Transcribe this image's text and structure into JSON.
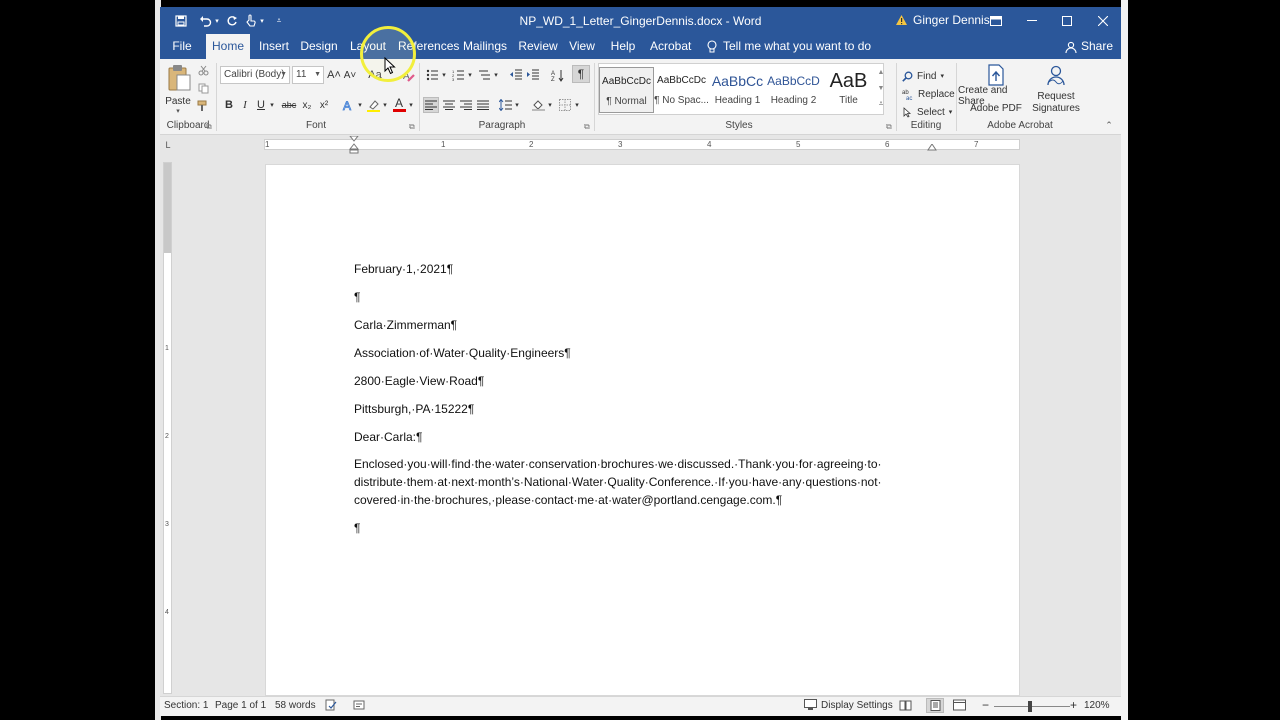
{
  "window": {
    "doc_title": "NP_WD_1_Letter_GingerDennis.docx  -  Word",
    "user_name": "Ginger Dennis"
  },
  "tabs": [
    {
      "label": "File"
    },
    {
      "label": "Home"
    },
    {
      "label": "Insert"
    },
    {
      "label": "Design"
    },
    {
      "label": "Layout"
    },
    {
      "label": "References"
    },
    {
      "label": "Mailings"
    },
    {
      "label": "Review"
    },
    {
      "label": "View"
    },
    {
      "label": "Help"
    },
    {
      "label": "Acrobat"
    }
  ],
  "tell_me": "Tell me what you want to do",
  "share": "Share",
  "ribbon": {
    "clipboard": {
      "label": "Clipboard",
      "paste": "Paste"
    },
    "font": {
      "label": "Font",
      "font_name": "Calibri (Body)",
      "font_size": "11",
      "bold": "B",
      "italic": "I",
      "underline": "U",
      "strike": "abc",
      "subscript": "x₂",
      "superscript": "x²",
      "font_color_letter": "A",
      "grow": "A˄",
      "shrink": "A˅",
      "case": "Aa"
    },
    "paragraph": {
      "label": "Paragraph",
      "pilcrow": "¶"
    },
    "styles": {
      "label": "Styles",
      "items": [
        {
          "sample": "AaBbCcDc",
          "name": "¶ Normal"
        },
        {
          "sample": "AaBbCcDc",
          "name": "¶ No Spac..."
        },
        {
          "sample": "AaBbCc",
          "name": "Heading 1"
        },
        {
          "sample": "AaBbCcD",
          "name": "Heading 2"
        },
        {
          "sample": "AaB",
          "name": "Title"
        }
      ]
    },
    "editing": {
      "label": "Editing",
      "find": "Find",
      "replace": "Replace",
      "select": "Select"
    },
    "acrobat": {
      "label": "Adobe Acrobat",
      "create_share_1": "Create and Share",
      "create_share_2": "Adobe PDF",
      "request_1": "Request",
      "request_2": "Signatures"
    }
  },
  "ruler_numbers": [
    "1",
    "1",
    "2",
    "3",
    "4",
    "5",
    "6",
    "7"
  ],
  "vruler_numbers": [
    "1",
    "2",
    "3",
    "4"
  ],
  "document": {
    "date": "February·1,·2021¶",
    "blank1": "¶",
    "name": "Carla·Zimmerman¶",
    "org": "Association·of·Water·Quality·Engineers¶",
    "street": "2800·Eagle·View·Road¶",
    "city": "Pittsburgh,·PA·15222¶",
    "salutation": "Dear·Carla:¶",
    "body_line1": "Enclosed·you·will·find·the·water·conservation·brochures·we·discussed.·Thank·you·for·agreeing·to·",
    "body_line2": "distribute·them·at·next·month’s·National·Water·Quality·Conference.·If·you·have·any·questions·not·",
    "body_line3": "covered·in·the·brochures,·please·contact·me·at·water@portland.cengage.com.¶",
    "blank2": "¶"
  },
  "status": {
    "section": "Section: 1",
    "page": "Page 1 of 1",
    "words": "58 words",
    "display_settings": "Display Settings",
    "zoom": "120%"
  },
  "colors": {
    "accent": "#2b579a",
    "highlight_ring": "#f2ef3c",
    "font_color_red": "#e00000",
    "highlighter_yellow": "#ffee00"
  }
}
